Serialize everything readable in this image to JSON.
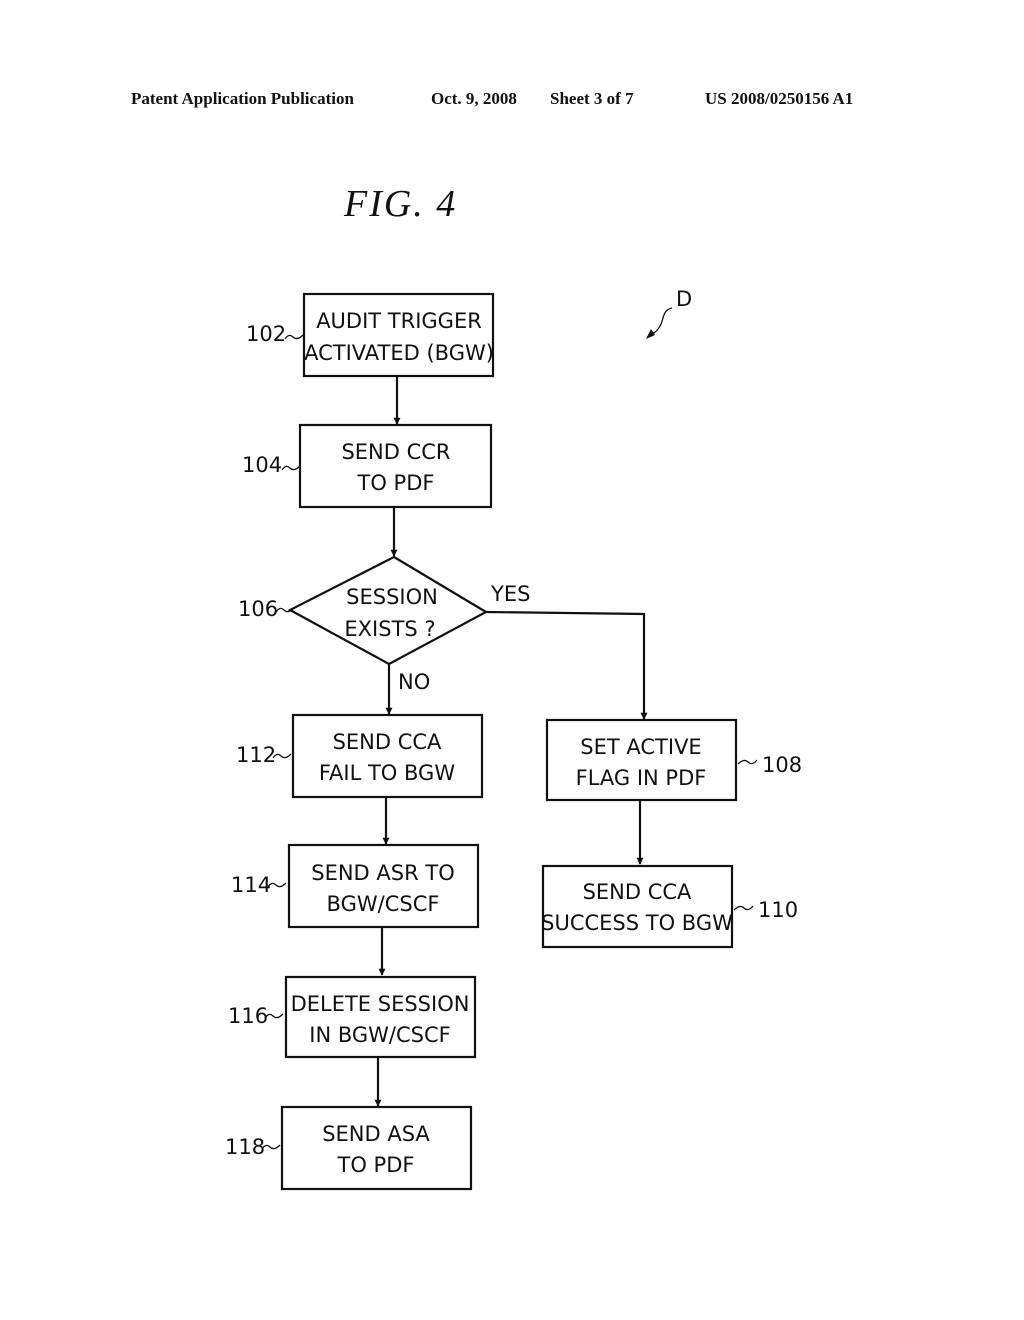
{
  "header": {
    "publication": "Patent Application Publication",
    "date": "Oct. 9, 2008",
    "sheet": "Sheet 3 of 7",
    "number": "US 2008/0250156 A1"
  },
  "figure": {
    "title": "FIG. 4",
    "ref_label": "D",
    "nodes": [
      {
        "id": "102",
        "type": "process",
        "lines": [
          "AUDIT TRIGGER",
          "ACTIVATED (BGW)"
        ]
      },
      {
        "id": "104",
        "type": "process",
        "lines": [
          "SEND CCR",
          "TO PDF"
        ]
      },
      {
        "id": "106",
        "type": "decision",
        "lines": [
          "SESSION",
          "EXISTS ?"
        ]
      },
      {
        "id": "108",
        "type": "process",
        "lines": [
          "SET ACTIVE",
          "FLAG IN PDF"
        ]
      },
      {
        "id": "110",
        "type": "process",
        "lines": [
          "SEND CCA",
          "SUCCESS TO BGW"
        ]
      },
      {
        "id": "112",
        "type": "process",
        "lines": [
          "SEND CCA",
          "FAIL TO BGW"
        ]
      },
      {
        "id": "114",
        "type": "process",
        "lines": [
          "SEND ASR TO",
          "BGW/CSCF"
        ]
      },
      {
        "id": "116",
        "type": "process",
        "lines": [
          "DELETE SESSION",
          "IN BGW/CSCF"
        ]
      },
      {
        "id": "118",
        "type": "process",
        "lines": [
          "SEND ASA",
          "TO PDF"
        ]
      }
    ],
    "edges": [
      {
        "from": "102",
        "to": "104",
        "label": ""
      },
      {
        "from": "104",
        "to": "106",
        "label": ""
      },
      {
        "from": "106",
        "to": "108",
        "label": "YES"
      },
      {
        "from": "106",
        "to": "112",
        "label": "NO"
      },
      {
        "from": "108",
        "to": "110",
        "label": ""
      },
      {
        "from": "112",
        "to": "114",
        "label": ""
      },
      {
        "from": "114",
        "to": "116",
        "label": ""
      },
      {
        "from": "116",
        "to": "118",
        "label": ""
      }
    ]
  }
}
